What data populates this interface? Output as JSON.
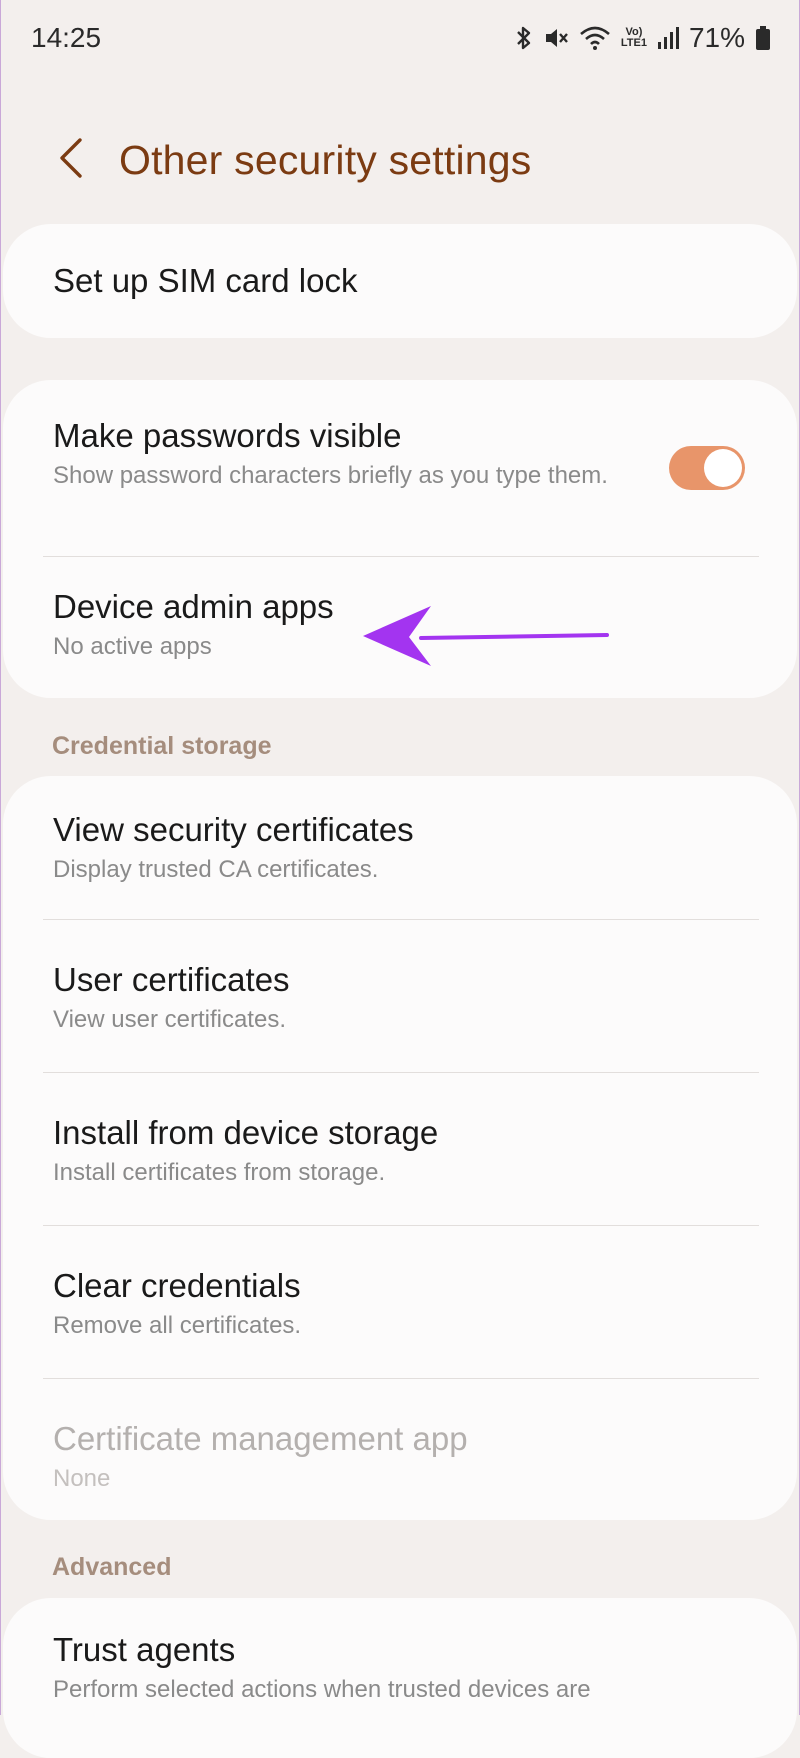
{
  "status_bar": {
    "time": "14:25",
    "lte_top": "Vo)",
    "lte_bottom": "LTE1",
    "battery": "71%",
    "icons": [
      "bluetooth-icon",
      "mute-icon",
      "wifi-icon",
      "signal-icon",
      "battery-icon"
    ]
  },
  "header": {
    "title": "Other security settings",
    "back_icon": "chevron-left-icon"
  },
  "sim_card": {
    "title": "Set up SIM card lock"
  },
  "security_group": {
    "passwords": {
      "title": "Make passwords visible",
      "subtitle": "Show password characters briefly as you type them.",
      "toggle_on": true
    },
    "device_admin": {
      "title": "Device admin apps",
      "subtitle": "No active apps"
    }
  },
  "credential_storage": {
    "label": "Credential storage",
    "items": [
      {
        "title": "View security certificates",
        "subtitle": "Display trusted CA certificates."
      },
      {
        "title": "User certificates",
        "subtitle": "View user certificates."
      },
      {
        "title": "Install from device storage",
        "subtitle": "Install certificates from storage."
      },
      {
        "title": "Clear credentials",
        "subtitle": "Remove all certificates."
      },
      {
        "title": "Certificate management app",
        "subtitle": "None"
      }
    ]
  },
  "advanced": {
    "label": "Advanced",
    "items": [
      {
        "title": "Trust agents",
        "subtitle": "Perform selected actions when trusted devices are"
      }
    ]
  },
  "colors": {
    "accent": "#e8956a",
    "title": "#7b3b12",
    "annotation": "#a334f0"
  }
}
